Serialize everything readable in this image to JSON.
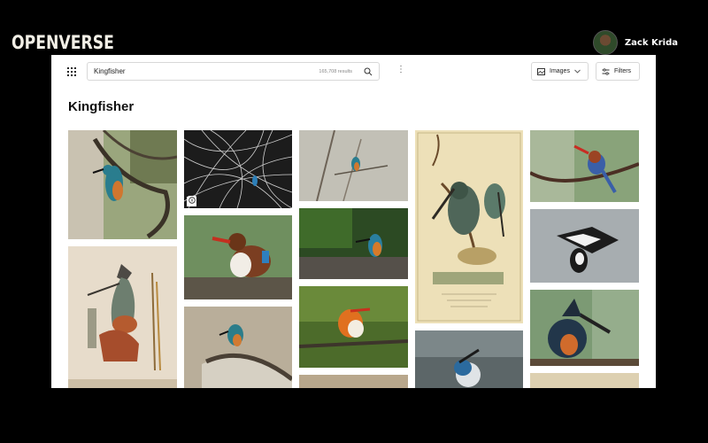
{
  "brand": "OPENVERSE",
  "speaker": {
    "name": "Zack Krida"
  },
  "search": {
    "query": "Kingfisher",
    "result_count": "165,708 results"
  },
  "filters": {
    "media_type_label": "Images",
    "filters_label": "Filters"
  },
  "page_title": "Kingfisher",
  "icons": {
    "menu": "grid-icon",
    "search": "search-icon",
    "more": "more-icon",
    "media": "image-icon",
    "chevron": "chevron-down-icon",
    "filters": "filter-icon",
    "license": "cc-license-icon"
  },
  "colors": {
    "background": "#000000",
    "brand_text": "#f2efe6",
    "page": "#ffffff"
  }
}
